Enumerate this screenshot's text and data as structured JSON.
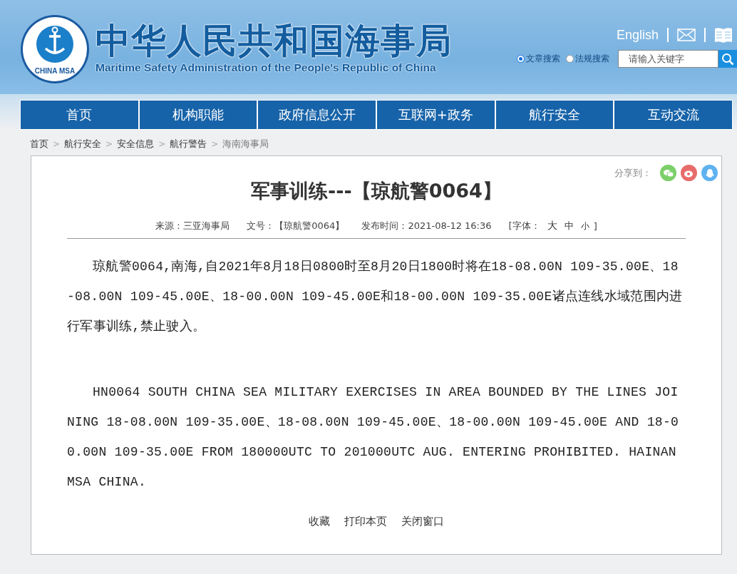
{
  "header": {
    "logo_text": "CHINA MSA",
    "title": "中华人民共和国海事局",
    "subtitle": "Maritime Safety Administration of the People's Republic of China",
    "english_link": "English"
  },
  "search": {
    "options": [
      {
        "label": "文章搜索",
        "selected": true
      },
      {
        "label": "法规搜索",
        "selected": false
      }
    ],
    "placeholder": "请输入关键字"
  },
  "nav": [
    "首页",
    "机构职能",
    "政府信息公开",
    "互联网+政务",
    "航行安全",
    "互动交流"
  ],
  "breadcrumb_separator": ">",
  "breadcrumb": [
    "首页",
    "航行安全",
    "安全信息",
    "航行警告",
    "海南海事局"
  ],
  "share": {
    "label": "分享到："
  },
  "article": {
    "title": "军事训练---【琼航警0064】",
    "meta": [
      "来源：三亚海事局",
      "文号：【琼航警0064】",
      "发布时间：2021-08-12 16:36"
    ],
    "font_label": "[字体：",
    "font_sizes": [
      "大",
      "中",
      "小"
    ],
    "font_close": "]",
    "paragraphs": [
      "琼航警0064,南海,自2021年8月18日0800时至8月20日1800时将在18-08.00N 109-35.00E、18-08.00N 109-45.00E、18-00.00N 109-45.00E和18-00.00N 109-35.00E诸点连线水域范围内进行军事训练,禁止驶入。",
      "HN0064 SOUTH CHINA SEA MILITARY EXERCISES IN AREA BOUNDED BY THE LINES JOINING 18-08.00N 109-35.00E、18-08.00N 109-45.00E、18-00.00N 109-45.00E AND 18-00.00N 109-35.00E FROM 180000UTC TO 201000UTC AUG. ENTERING PROHIBITED. HAINAN MSA CHINA."
    ],
    "actions": [
      "收藏",
      "打印本页",
      "关闭窗口"
    ]
  }
}
